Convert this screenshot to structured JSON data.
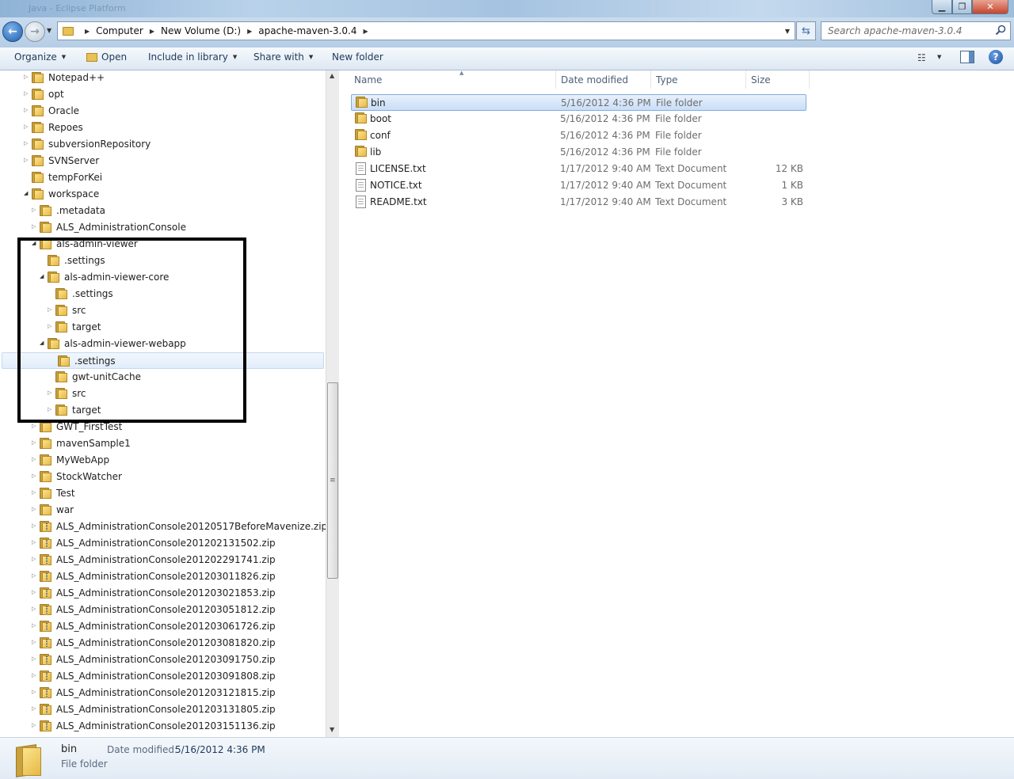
{
  "window": {
    "title": "Java - Eclipse Platform"
  },
  "address": {
    "crumbs": [
      "Computer",
      "New Volume (D:)",
      "apache-maven-3.0.4"
    ]
  },
  "search": {
    "placeholder": "Search apache-maven-3.0.4"
  },
  "toolbar": {
    "organize": "Organize",
    "open": "Open",
    "include_in_library": "Include in library",
    "share_with": "Share with",
    "new_folder": "New folder"
  },
  "nav_tree": [
    {
      "label": "Notepad++",
      "depth": 0,
      "expander": "collapsed",
      "icon": "folder-icon"
    },
    {
      "label": "opt",
      "depth": 0,
      "expander": "collapsed",
      "icon": "folder-icon"
    },
    {
      "label": "Oracle",
      "depth": 0,
      "expander": "collapsed",
      "icon": "folder-icon"
    },
    {
      "label": "Repoes",
      "depth": 0,
      "expander": "collapsed",
      "icon": "folder-icon"
    },
    {
      "label": "subversionRepository",
      "depth": 0,
      "expander": "collapsed",
      "icon": "folder-icon"
    },
    {
      "label": "SVNServer",
      "depth": 0,
      "expander": "collapsed",
      "icon": "folder-icon"
    },
    {
      "label": "tempForKei",
      "depth": 0,
      "expander": "none",
      "icon": "folder-icon"
    },
    {
      "label": "workspace",
      "depth": 0,
      "expander": "expanded",
      "icon": "folder-icon"
    },
    {
      "label": ".metadata",
      "depth": 1,
      "expander": "collapsed",
      "icon": "folder-icon"
    },
    {
      "label": "ALS_AdministrationConsole",
      "depth": 1,
      "expander": "collapsed",
      "icon": "folder-icon"
    },
    {
      "label": "als-admin-viewer",
      "depth": 1,
      "expander": "expanded",
      "icon": "folder-icon"
    },
    {
      "label": ".settings",
      "depth": 2,
      "expander": "none",
      "icon": "folder-icon"
    },
    {
      "label": "als-admin-viewer-core",
      "depth": 2,
      "expander": "expanded",
      "icon": "folder-icon"
    },
    {
      "label": ".settings",
      "depth": 3,
      "expander": "none",
      "icon": "folder-icon"
    },
    {
      "label": "src",
      "depth": 3,
      "expander": "collapsed",
      "icon": "folder-icon"
    },
    {
      "label": "target",
      "depth": 3,
      "expander": "collapsed",
      "icon": "folder-icon"
    },
    {
      "label": "als-admin-viewer-webapp",
      "depth": 2,
      "expander": "expanded",
      "icon": "folder-icon"
    },
    {
      "label": ".settings",
      "depth": 3,
      "expander": "none",
      "icon": "folder-icon",
      "selected": true
    },
    {
      "label": "gwt-unitCache",
      "depth": 3,
      "expander": "none",
      "icon": "folder-icon"
    },
    {
      "label": "src",
      "depth": 3,
      "expander": "collapsed",
      "icon": "folder-icon"
    },
    {
      "label": "target",
      "depth": 3,
      "expander": "collapsed",
      "icon": "folder-icon"
    },
    {
      "label": "GWT_FirstTest",
      "depth": 1,
      "expander": "collapsed",
      "icon": "folder-icon"
    },
    {
      "label": "mavenSample1",
      "depth": 1,
      "expander": "collapsed",
      "icon": "folder-icon"
    },
    {
      "label": "MyWebApp",
      "depth": 1,
      "expander": "collapsed",
      "icon": "folder-icon"
    },
    {
      "label": "StockWatcher",
      "depth": 1,
      "expander": "collapsed",
      "icon": "folder-icon"
    },
    {
      "label": "Test",
      "depth": 1,
      "expander": "collapsed",
      "icon": "folder-icon"
    },
    {
      "label": "war",
      "depth": 1,
      "expander": "collapsed",
      "icon": "folder-icon"
    },
    {
      "label": "ALS_AdministrationConsole20120517BeforeMavenize.zip",
      "depth": 1,
      "expander": "collapsed",
      "icon": "zip-folder-icon"
    },
    {
      "label": "ALS_AdministrationConsole201202131502.zip",
      "depth": 1,
      "expander": "collapsed",
      "icon": "zip-folder-icon"
    },
    {
      "label": "ALS_AdministrationConsole201202291741.zip",
      "depth": 1,
      "expander": "collapsed",
      "icon": "zip-folder-icon"
    },
    {
      "label": "ALS_AdministrationConsole201203011826.zip",
      "depth": 1,
      "expander": "collapsed",
      "icon": "zip-folder-icon"
    },
    {
      "label": "ALS_AdministrationConsole201203021853.zip",
      "depth": 1,
      "expander": "collapsed",
      "icon": "zip-folder-icon"
    },
    {
      "label": "ALS_AdministrationConsole201203051812.zip",
      "depth": 1,
      "expander": "collapsed",
      "icon": "zip-folder-icon"
    },
    {
      "label": "ALS_AdministrationConsole201203061726.zip",
      "depth": 1,
      "expander": "collapsed",
      "icon": "zip-folder-icon"
    },
    {
      "label": "ALS_AdministrationConsole201203081820.zip",
      "depth": 1,
      "expander": "collapsed",
      "icon": "zip-folder-icon"
    },
    {
      "label": "ALS_AdministrationConsole201203091750.zip",
      "depth": 1,
      "expander": "collapsed",
      "icon": "zip-folder-icon"
    },
    {
      "label": "ALS_AdministrationConsole201203091808.zip",
      "depth": 1,
      "expander": "collapsed",
      "icon": "zip-folder-icon"
    },
    {
      "label": "ALS_AdministrationConsole201203121815.zip",
      "depth": 1,
      "expander": "collapsed",
      "icon": "zip-folder-icon"
    },
    {
      "label": "ALS_AdministrationConsole201203131805.zip",
      "depth": 1,
      "expander": "collapsed",
      "icon": "zip-folder-icon"
    },
    {
      "label": "ALS_AdministrationConsole201203151136.zip",
      "depth": 1,
      "expander": "collapsed",
      "icon": "zip-folder-icon"
    }
  ],
  "columns": {
    "name": "Name",
    "date_modified": "Date modified",
    "type": "Type",
    "size": "Size"
  },
  "files": [
    {
      "name": "bin",
      "date": "5/16/2012 4:36 PM",
      "type": "File folder",
      "size": "",
      "icon": "folder-icon",
      "selected": true
    },
    {
      "name": "boot",
      "date": "5/16/2012 4:36 PM",
      "type": "File folder",
      "size": "",
      "icon": "folder-icon"
    },
    {
      "name": "conf",
      "date": "5/16/2012 4:36 PM",
      "type": "File folder",
      "size": "",
      "icon": "folder-icon"
    },
    {
      "name": "lib",
      "date": "5/16/2012 4:36 PM",
      "type": "File folder",
      "size": "",
      "icon": "folder-icon"
    },
    {
      "name": "LICENSE.txt",
      "date": "1/17/2012 9:40 AM",
      "type": "Text Document",
      "size": "12 KB",
      "icon": "text-file-icon"
    },
    {
      "name": "NOTICE.txt",
      "date": "1/17/2012 9:40 AM",
      "type": "Text Document",
      "size": "1 KB",
      "icon": "text-file-icon"
    },
    {
      "name": "README.txt",
      "date": "1/17/2012 9:40 AM",
      "type": "Text Document",
      "size": "3 KB",
      "icon": "text-file-icon"
    }
  ],
  "details": {
    "name": "bin",
    "type": "File folder",
    "modified_label": "Date modified:",
    "modified_value": "5/16/2012 4:36 PM"
  },
  "colors": {
    "accent": "#3399ff",
    "selection_border": "#84acdd",
    "annotation_box": "#000000"
  }
}
